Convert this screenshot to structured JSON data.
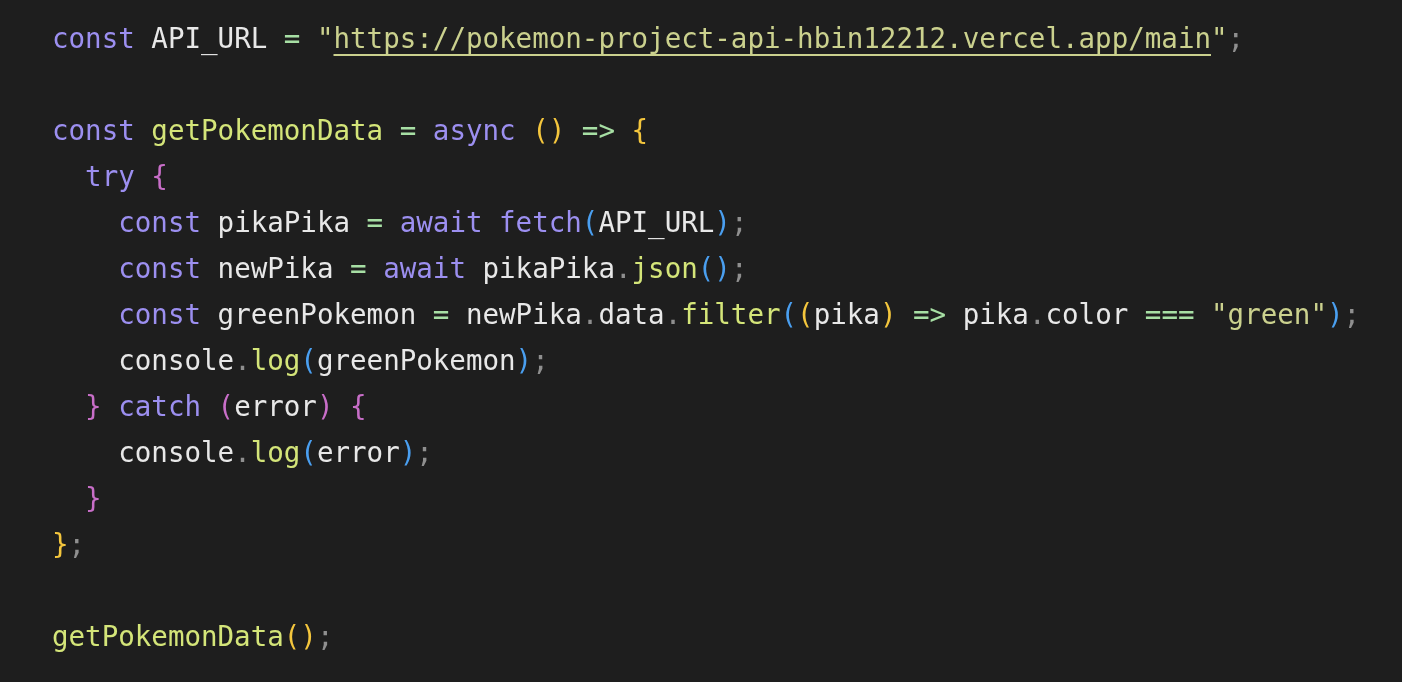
{
  "code_blocks": [
    {
      "lines": [
        {
          "tokens": [
            {
              "kind": "keyword",
              "text": "const"
            },
            {
              "kind": "ident",
              "text": " API_URL "
            },
            {
              "kind": "op",
              "text": "="
            },
            {
              "kind": "string",
              "text": " \""
            },
            {
              "kind": "link",
              "text": "https://pokemon-project-api-hbin12212.vercel.app/main"
            },
            {
              "kind": "string",
              "text": "\""
            },
            {
              "kind": "punct",
              "text": ";"
            }
          ]
        }
      ]
    },
    {
      "lines": [
        {
          "tokens": [
            {
              "kind": "keyword",
              "text": "const"
            },
            {
              "kind": "func",
              "text": " getPokemonData "
            },
            {
              "kind": "op",
              "text": "="
            },
            {
              "kind": "keyword",
              "text": " async "
            },
            {
              "kind": "bracket",
              "text": "()",
              "color": "#f4c63d"
            },
            {
              "kind": "op",
              "text": " => "
            },
            {
              "kind": "bracket",
              "text": "{",
              "color": "#f4c63d"
            }
          ]
        },
        {
          "tokens": [
            {
              "kind": "keyword",
              "text": "  try "
            },
            {
              "kind": "bracket",
              "text": "{",
              "color": "#c86ec8"
            }
          ]
        },
        {
          "tokens": [
            {
              "kind": "keyword",
              "text": "    const"
            },
            {
              "kind": "ident",
              "text": " pikaPika "
            },
            {
              "kind": "op",
              "text": "="
            },
            {
              "kind": "keyword",
              "text": " await fetch"
            },
            {
              "kind": "bracket",
              "text": "(",
              "color": "#4a9ff0"
            },
            {
              "kind": "ident",
              "text": "API_URL"
            },
            {
              "kind": "bracket",
              "text": ")",
              "color": "#4a9ff0"
            },
            {
              "kind": "punct",
              "text": ";"
            }
          ]
        },
        {
          "tokens": [
            {
              "kind": "keyword",
              "text": "    const"
            },
            {
              "kind": "ident",
              "text": " newPika "
            },
            {
              "kind": "op",
              "text": "="
            },
            {
              "kind": "keyword",
              "text": " await"
            },
            {
              "kind": "ident",
              "text": " pikaPika"
            },
            {
              "kind": "punct",
              "text": "."
            },
            {
              "kind": "func",
              "text": "json"
            },
            {
              "kind": "bracket",
              "text": "()",
              "color": "#4a9ff0"
            },
            {
              "kind": "punct",
              "text": ";"
            }
          ]
        },
        {
          "tokens": [
            {
              "kind": "keyword",
              "text": "    const"
            },
            {
              "kind": "ident",
              "text": " greenPokemon "
            },
            {
              "kind": "op",
              "text": "="
            },
            {
              "kind": "ident",
              "text": " newPika"
            },
            {
              "kind": "punct",
              "text": "."
            },
            {
              "kind": "ident",
              "text": "data"
            },
            {
              "kind": "punct",
              "text": "."
            },
            {
              "kind": "func",
              "text": "filter"
            },
            {
              "kind": "bracket",
              "text": "(",
              "color": "#4a9ff0"
            },
            {
              "kind": "bracket",
              "text": "(",
              "color": "#f4c63d"
            },
            {
              "kind": "ident",
              "text": "pika"
            },
            {
              "kind": "bracket",
              "text": ")",
              "color": "#f4c63d"
            },
            {
              "kind": "op",
              "text": " => "
            },
            {
              "kind": "ident",
              "text": "pika"
            },
            {
              "kind": "punct",
              "text": "."
            },
            {
              "kind": "ident",
              "text": "color "
            },
            {
              "kind": "op",
              "text": "==="
            },
            {
              "kind": "string",
              "text": " \"green\""
            },
            {
              "kind": "bracket",
              "text": ")",
              "color": "#4a9ff0"
            },
            {
              "kind": "punct",
              "text": ";"
            }
          ]
        },
        {
          "tokens": [
            {
              "kind": "ident",
              "text": "    console"
            },
            {
              "kind": "punct",
              "text": "."
            },
            {
              "kind": "func",
              "text": "log"
            },
            {
              "kind": "bracket",
              "text": "(",
              "color": "#4a9ff0"
            },
            {
              "kind": "ident",
              "text": "greenPokemon"
            },
            {
              "kind": "bracket",
              "text": ")",
              "color": "#4a9ff0"
            },
            {
              "kind": "punct",
              "text": ";"
            }
          ]
        },
        {
          "tokens": [
            {
              "kind": "bracket",
              "text": "  }",
              "color": "#c86ec8"
            },
            {
              "kind": "keyword",
              "text": " catch "
            },
            {
              "kind": "bracket",
              "text": "(",
              "color": "#c86ec8"
            },
            {
              "kind": "ident",
              "text": "error"
            },
            {
              "kind": "bracket",
              "text": ")",
              "color": "#c86ec8"
            },
            {
              "kind": "bracket",
              "text": " {",
              "color": "#c86ec8"
            }
          ]
        },
        {
          "tokens": [
            {
              "kind": "ident",
              "text": "    console"
            },
            {
              "kind": "punct",
              "text": "."
            },
            {
              "kind": "func",
              "text": "log"
            },
            {
              "kind": "bracket",
              "text": "(",
              "color": "#4a9ff0"
            },
            {
              "kind": "ident",
              "text": "error"
            },
            {
              "kind": "bracket",
              "text": ")",
              "color": "#4a9ff0"
            },
            {
              "kind": "punct",
              "text": ";"
            }
          ]
        },
        {
          "tokens": [
            {
              "kind": "bracket",
              "text": "  }",
              "color": "#c86ec8"
            }
          ]
        },
        {
          "tokens": [
            {
              "kind": "bracket",
              "text": "}",
              "color": "#f4c63d"
            },
            {
              "kind": "punct",
              "text": ";"
            }
          ]
        }
      ]
    },
    {
      "lines": [
        {
          "tokens": [
            {
              "kind": "func",
              "text": "getPokemonData"
            },
            {
              "kind": "bracket",
              "text": "()",
              "color": "#f4c63d"
            },
            {
              "kind": "punct",
              "text": ";"
            }
          ]
        }
      ]
    }
  ]
}
